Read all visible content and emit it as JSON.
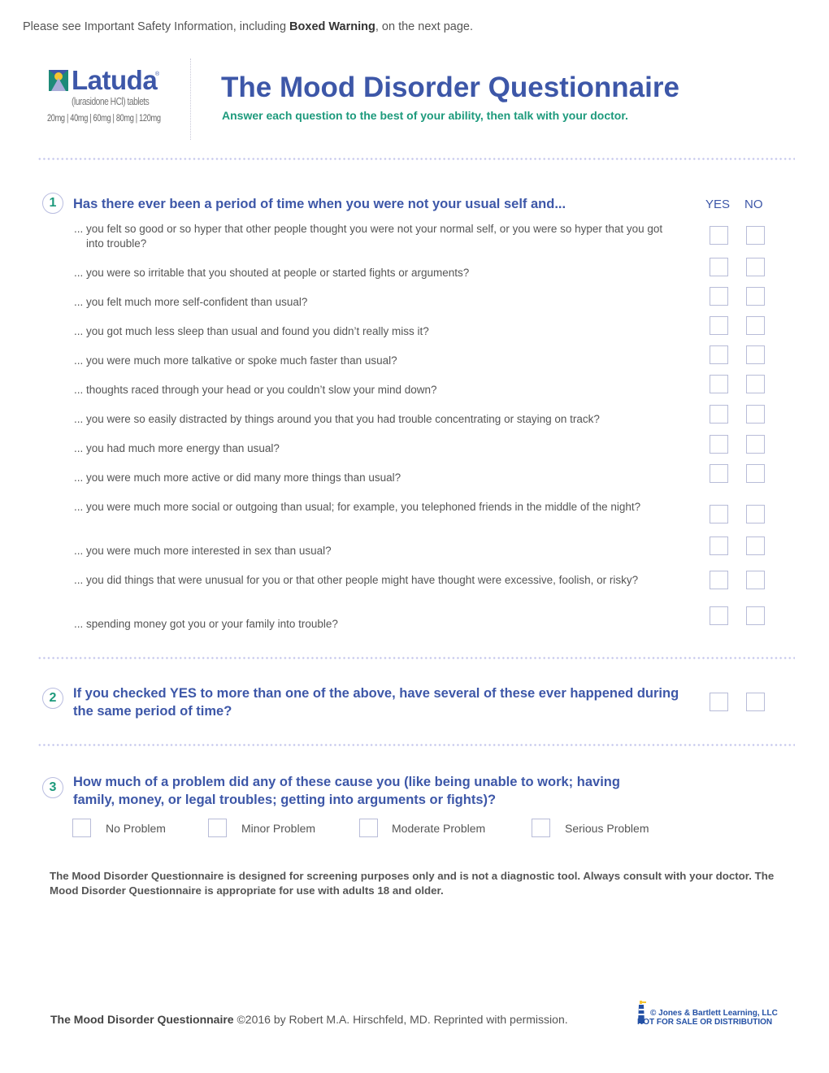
{
  "safety_notice": {
    "prefix": "Please see Important Safety Information, including ",
    "bold": "Boxed Warning",
    "suffix": ", on the next page."
  },
  "logo": {
    "brand": "Latuda",
    "registered": "®",
    "generic": "(lurasidone HCl) tablets",
    "doses": "20mg | 40mg | 60mg | 80mg | 120mg",
    "colors": {
      "blue": "#3d57a8",
      "teal": "#1d8a78",
      "yellow": "#f5c431",
      "lavender": "#a9acd8"
    }
  },
  "header": {
    "title_prefix": "The ",
    "title_bold": "Mood Disorder Questionnaire",
    "subtitle": "Answer each question to the best of your ability, then talk with your doctor."
  },
  "columns": {
    "yes": "YES",
    "no": "NO"
  },
  "question1": {
    "number": "1",
    "text": "Has there ever been a period of time when you were not your usual self and...",
    "items": [
      {
        "text": "... you felt so good or so hyper that other people thought you were not your normal self, or you were so hyper that you got into trouble?",
        "yes": false,
        "no": false
      },
      {
        "text": "... you were so irritable that you shouted at people or started fights or arguments?",
        "yes": false,
        "no": false
      },
      {
        "text": "... you felt much more self-confident than usual?",
        "yes": false,
        "no": false
      },
      {
        "text": "... you got much less sleep than usual and found you didn’t really miss it?",
        "yes": false,
        "no": false
      },
      {
        "text": "... you were much more talkative or spoke much faster than usual?",
        "yes": false,
        "no": false
      },
      {
        "text": "... thoughts raced through your head or you couldn’t slow your mind down?",
        "yes": false,
        "no": false
      },
      {
        "text": "... you were so easily distracted by things around you that you had trouble concentrating or staying on track?",
        "yes": false,
        "no": false
      },
      {
        "text": "... you had much more energy than usual?",
        "yes": false,
        "no": false
      },
      {
        "text": "... you were much more active or did many more things than usual?",
        "yes": false,
        "no": false
      },
      {
        "text": "... you were much more social or outgoing than usual; for example, you telephoned friends in the middle of the night?",
        "yes": false,
        "no": false
      },
      {
        "text": "... you were much more interested in sex than usual?",
        "yes": false,
        "no": false
      },
      {
        "text": "... you did things that were unusual for you or that other people might have thought were excessive, foolish, or risky?",
        "yes": false,
        "no": false
      },
      {
        "text": "... spending money got you or your family into trouble?",
        "yes": false,
        "no": false
      }
    ]
  },
  "question2": {
    "number": "2",
    "text": "If you checked YES to more than one of the above, have several of these ever happened during the same period of time?",
    "yes": false,
    "no": false
  },
  "question3": {
    "number": "3",
    "text": "How much of a problem did any of these cause you (like being unable to work; having family, money, or legal troubles; getting into arguments or fights)?",
    "options": [
      {
        "label": "No Problem",
        "checked": false
      },
      {
        "label": "Minor Problem",
        "checked": false
      },
      {
        "label": "Moderate Problem",
        "checked": false
      },
      {
        "label": "Serious Problem",
        "checked": false
      }
    ]
  },
  "disclaimer": "The Mood Disorder Questionnaire is designed for screening purposes only and is not a diagnostic tool. Always consult with your doctor. The Mood Disorder Questionnaire is appropriate for use with adults 18 and older.",
  "footer": {
    "bold": "The Mood Disorder Questionnaire",
    "text": " ©2016 by Robert M.A. Hirschfeld, MD. Reprinted with permission."
  },
  "watermark": {
    "line1": "© Jones & Bartlett Learning, LLC",
    "line2": "NOT FOR SALE OR DISTRIBUTION"
  }
}
